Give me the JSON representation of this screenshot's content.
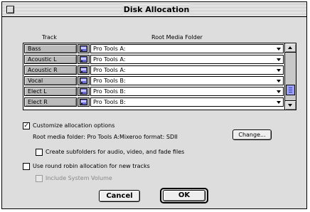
{
  "window": {
    "title": "Disk Allocation"
  },
  "table": {
    "col_track": "Track",
    "col_folder": "Root Media Folder",
    "rows": [
      {
        "track": "Bass",
        "folder": "Pro Tools A:"
      },
      {
        "track": "Acoustic L",
        "folder": "Pro Tools A:"
      },
      {
        "track": "Acoustic R",
        "folder": "Pro Tools A:"
      },
      {
        "track": "Vocal",
        "folder": "Pro Tools B:"
      },
      {
        "track": "Elect L",
        "folder": "Pro Tools B:"
      },
      {
        "track": "Elect R",
        "folder": "Pro Tools B:"
      }
    ]
  },
  "options": {
    "customize_label": "Customize allocation options",
    "customize_checked": true,
    "root_folder_text": "Root media folder:   Pro Tools A:Mixeroo  format: SDII",
    "change_button": "Change...",
    "subfolders_label": "Create subfolders for audio, video, and fade files",
    "subfolders_checked": false,
    "round_robin_label": "Use round robin allocation for new tracks",
    "round_robin_checked": false,
    "include_system_label": "Include System Volume",
    "include_system_checked": false
  },
  "buttons": {
    "cancel": "Cancel",
    "ok": "OK"
  },
  "icons": {
    "close": "close-box-icon",
    "disk": "disk-icon"
  },
  "colors": {
    "scroll_thumb": "#9aa0ff"
  }
}
